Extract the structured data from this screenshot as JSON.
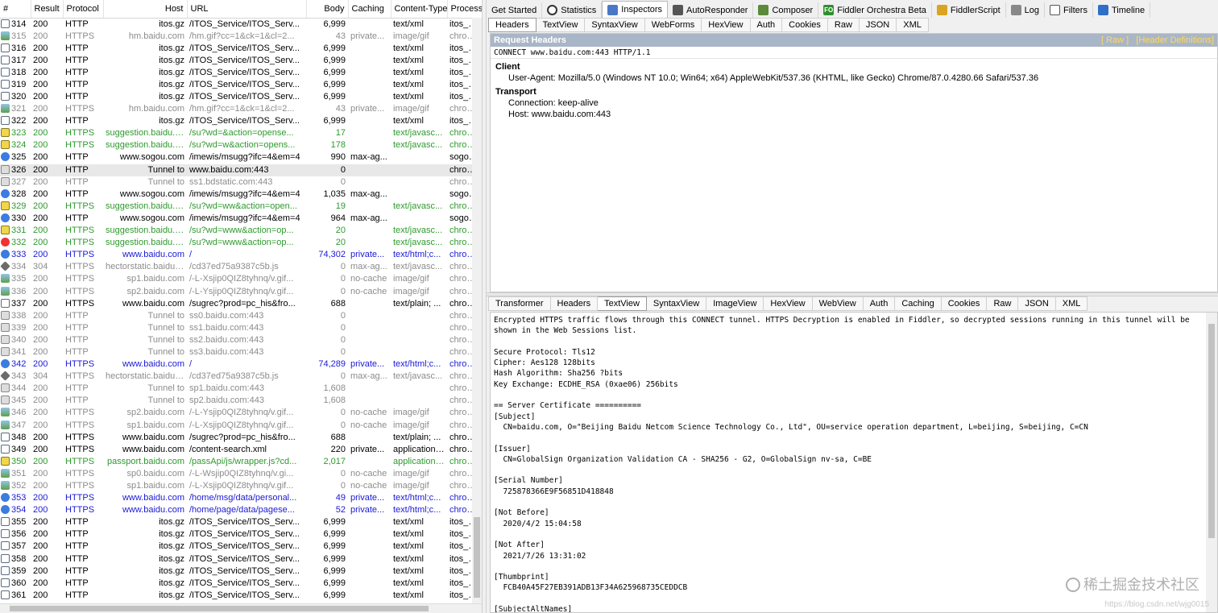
{
  "sessions": {
    "columns": [
      "#",
      "Result",
      "Protocol",
      "Host",
      "URL",
      "Body",
      "Caching",
      "Content-Type",
      "Process"
    ],
    "rows": [
      {
        "id": "314",
        "result": "200",
        "protocol": "HTTP",
        "host": "itos.gz",
        "url": "/ITOS_Service/ITOS_Serv...",
        "body": "6,999",
        "caching": "",
        "ctype": "text/xml",
        "process": "itos_se...",
        "color": "#000000",
        "icon": "doc-icon"
      },
      {
        "id": "315",
        "result": "200",
        "protocol": "HTTPS",
        "host": "hm.baidu.com",
        "url": "/hm.gif?cc=1&ck=1&cl=2...",
        "body": "43",
        "caching": "private...",
        "ctype": "image/gif",
        "process": "chrome...",
        "color": "#8c8c8c",
        "icon": "image-icon"
      },
      {
        "id": "316",
        "result": "200",
        "protocol": "HTTP",
        "host": "itos.gz",
        "url": "/ITOS_Service/ITOS_Serv...",
        "body": "6,999",
        "caching": "",
        "ctype": "text/xml",
        "process": "itos_se...",
        "color": "#000000",
        "icon": "doc-icon"
      },
      {
        "id": "317",
        "result": "200",
        "protocol": "HTTP",
        "host": "itos.gz",
        "url": "/ITOS_Service/ITOS_Serv...",
        "body": "6,999",
        "caching": "",
        "ctype": "text/xml",
        "process": "itos_se...",
        "color": "#000000",
        "icon": "doc-icon"
      },
      {
        "id": "318",
        "result": "200",
        "protocol": "HTTP",
        "host": "itos.gz",
        "url": "/ITOS_Service/ITOS_Serv...",
        "body": "6,999",
        "caching": "",
        "ctype": "text/xml",
        "process": "itos_se...",
        "color": "#000000",
        "icon": "doc-icon"
      },
      {
        "id": "319",
        "result": "200",
        "protocol": "HTTP",
        "host": "itos.gz",
        "url": "/ITOS_Service/ITOS_Serv...",
        "body": "6,999",
        "caching": "",
        "ctype": "text/xml",
        "process": "itos_se...",
        "color": "#000000",
        "icon": "doc-icon"
      },
      {
        "id": "320",
        "result": "200",
        "protocol": "HTTP",
        "host": "itos.gz",
        "url": "/ITOS_Service/ITOS_Serv...",
        "body": "6,999",
        "caching": "",
        "ctype": "text/xml",
        "process": "itos_se...",
        "color": "#000000",
        "icon": "doc-icon"
      },
      {
        "id": "321",
        "result": "200",
        "protocol": "HTTPS",
        "host": "hm.baidu.com",
        "url": "/hm.gif?cc=1&ck=1&cl=2...",
        "body": "43",
        "caching": "private...",
        "ctype": "image/gif",
        "process": "chrome...",
        "color": "#8c8c8c",
        "icon": "image-icon"
      },
      {
        "id": "322",
        "result": "200",
        "protocol": "HTTP",
        "host": "itos.gz",
        "url": "/ITOS_Service/ITOS_Serv...",
        "body": "6,999",
        "caching": "",
        "ctype": "text/xml",
        "process": "itos_se...",
        "color": "#000000",
        "icon": "doc-icon"
      },
      {
        "id": "323",
        "result": "200",
        "protocol": "HTTPS",
        "host": "suggestion.baidu.com",
        "url": "/su?wd=&action=opense...",
        "body": "17",
        "caching": "",
        "ctype": "text/javasc...",
        "process": "chrome...",
        "color": "#2e9a2e",
        "icon": "js-icon"
      },
      {
        "id": "324",
        "result": "200",
        "protocol": "HTTPS",
        "host": "suggestion.baidu.com",
        "url": "/su?wd=w&action=opens...",
        "body": "178",
        "caching": "",
        "ctype": "text/javasc...",
        "process": "chrome...",
        "color": "#2e9a2e",
        "icon": "js-icon"
      },
      {
        "id": "325",
        "result": "200",
        "protocol": "HTTP",
        "host": "www.sogou.com",
        "url": "/imewis/msugg?ifc=4&em=4",
        "body": "990",
        "caching": "max-ag...",
        "ctype": "",
        "process": "sogoucl...",
        "color": "#000000",
        "icon": "arrow-icon"
      },
      {
        "id": "326",
        "result": "200",
        "protocol": "HTTP",
        "host": "Tunnel to",
        "url": "www.baidu.com:443",
        "body": "0",
        "caching": "",
        "ctype": "",
        "process": "chrome...",
        "color": "#000000",
        "icon": "lock-icon"
      },
      {
        "id": "327",
        "result": "200",
        "protocol": "HTTP",
        "host": "Tunnel to",
        "url": "ss1.bdstatic.com:443",
        "body": "0",
        "caching": "",
        "ctype": "",
        "process": "chrome...",
        "color": "#8c8c8c",
        "icon": "lock-icon"
      },
      {
        "id": "328",
        "result": "200",
        "protocol": "HTTP",
        "host": "www.sogou.com",
        "url": "/imewis/msugg?ifc=4&em=4",
        "body": "1,035",
        "caching": "max-ag...",
        "ctype": "",
        "process": "sogoucl...",
        "color": "#000000",
        "icon": "arrow-icon"
      },
      {
        "id": "329",
        "result": "200",
        "protocol": "HTTPS",
        "host": "suggestion.baidu.com",
        "url": "/su?wd=ww&action=open...",
        "body": "19",
        "caching": "",
        "ctype": "text/javasc...",
        "process": "chrome...",
        "color": "#2e9a2e",
        "icon": "js-icon"
      },
      {
        "id": "330",
        "result": "200",
        "protocol": "HTTP",
        "host": "www.sogou.com",
        "url": "/imewis/msugg?ifc=4&em=4",
        "body": "964",
        "caching": "max-ag...",
        "ctype": "",
        "process": "sogoucl...",
        "color": "#000000",
        "icon": "arrow-icon"
      },
      {
        "id": "331",
        "result": "200",
        "protocol": "HTTPS",
        "host": "suggestion.baidu.com",
        "url": "/su?wd=www&action=op...",
        "body": "20",
        "caching": "",
        "ctype": "text/javasc...",
        "process": "chrome...",
        "color": "#2e9a2e",
        "icon": "js-icon"
      },
      {
        "id": "332",
        "result": "200",
        "protocol": "HTTPS",
        "host": "suggestion.baidu.com",
        "url": "/su?wd=www&action=op...",
        "body": "20",
        "caching": "",
        "ctype": "text/javasc...",
        "process": "chrome...",
        "color": "#2e9a2e",
        "icon": "stop-icon"
      },
      {
        "id": "333",
        "result": "200",
        "protocol": "HTTPS",
        "host": "www.baidu.com",
        "url": "/",
        "body": "74,302",
        "caching": "private...",
        "ctype": "text/html;c...",
        "process": "chrome...",
        "color": "#1a1ad6",
        "icon": "arrow-icon"
      },
      {
        "id": "334",
        "result": "304",
        "protocol": "HTTPS",
        "host": "hectorstatic.baidu.c...",
        "url": "/cd37ed75a9387c5b.js",
        "body": "0",
        "caching": "max-ag...",
        "ctype": "text/javasc...",
        "process": "chrome...",
        "color": "#8c8c8c",
        "icon": "css-icon"
      },
      {
        "id": "335",
        "result": "200",
        "protocol": "HTTPS",
        "host": "sp1.baidu.com",
        "url": "/-L-Xsjip0QIZ8tyhnq/v.gif...",
        "body": "0",
        "caching": "no-cache",
        "ctype": "image/gif",
        "process": "chrome...",
        "color": "#8c8c8c",
        "icon": "image-icon"
      },
      {
        "id": "336",
        "result": "200",
        "protocol": "HTTPS",
        "host": "sp2.baidu.com",
        "url": "/-L-Ysjip0QIZ8tyhnq/v.gif...",
        "body": "0",
        "caching": "no-cache",
        "ctype": "image/gif",
        "process": "chrome...",
        "color": "#8c8c8c",
        "icon": "image-icon"
      },
      {
        "id": "337",
        "result": "200",
        "protocol": "HTTPS",
        "host": "www.baidu.com",
        "url": "/sugrec?prod=pc_his&fro...",
        "body": "688",
        "caching": "",
        "ctype": "text/plain; ...",
        "process": "chrome...",
        "color": "#000000",
        "icon": "doc-icon"
      },
      {
        "id": "338",
        "result": "200",
        "protocol": "HTTP",
        "host": "Tunnel to",
        "url": "ss0.baidu.com:443",
        "body": "0",
        "caching": "",
        "ctype": "",
        "process": "chrome...",
        "color": "#8c8c8c",
        "icon": "lock-icon"
      },
      {
        "id": "339",
        "result": "200",
        "protocol": "HTTP",
        "host": "Tunnel to",
        "url": "ss1.baidu.com:443",
        "body": "0",
        "caching": "",
        "ctype": "",
        "process": "chrome...",
        "color": "#8c8c8c",
        "icon": "lock-icon"
      },
      {
        "id": "340",
        "result": "200",
        "protocol": "HTTP",
        "host": "Tunnel to",
        "url": "ss2.baidu.com:443",
        "body": "0",
        "caching": "",
        "ctype": "",
        "process": "chrome...",
        "color": "#8c8c8c",
        "icon": "lock-icon"
      },
      {
        "id": "341",
        "result": "200",
        "protocol": "HTTP",
        "host": "Tunnel to",
        "url": "ss3.baidu.com:443",
        "body": "0",
        "caching": "",
        "ctype": "",
        "process": "chrome...",
        "color": "#8c8c8c",
        "icon": "lock-icon"
      },
      {
        "id": "342",
        "result": "200",
        "protocol": "HTTPS",
        "host": "www.baidu.com",
        "url": "/",
        "body": "74,289",
        "caching": "private...",
        "ctype": "text/html;c...",
        "process": "chrome...",
        "color": "#1a1ad6",
        "icon": "arrow-icon"
      },
      {
        "id": "343",
        "result": "304",
        "protocol": "HTTPS",
        "host": "hectorstatic.baidu.c...",
        "url": "/cd37ed75a9387c5b.js",
        "body": "0",
        "caching": "max-ag...",
        "ctype": "text/javasc...",
        "process": "chrome...",
        "color": "#8c8c8c",
        "icon": "css-icon"
      },
      {
        "id": "344",
        "result": "200",
        "protocol": "HTTP",
        "host": "Tunnel to",
        "url": "sp1.baidu.com:443",
        "body": "1,608",
        "caching": "",
        "ctype": "",
        "process": "chrome...",
        "color": "#8c8c8c",
        "icon": "lock-icon"
      },
      {
        "id": "345",
        "result": "200",
        "protocol": "HTTP",
        "host": "Tunnel to",
        "url": "sp2.baidu.com:443",
        "body": "1,608",
        "caching": "",
        "ctype": "",
        "process": "chrome...",
        "color": "#8c8c8c",
        "icon": "lock-icon"
      },
      {
        "id": "346",
        "result": "200",
        "protocol": "HTTPS",
        "host": "sp2.baidu.com",
        "url": "/-L-Ysjip0QIZ8tyhnq/v.gif...",
        "body": "0",
        "caching": "no-cache",
        "ctype": "image/gif",
        "process": "chrome...",
        "color": "#8c8c8c",
        "icon": "image-icon"
      },
      {
        "id": "347",
        "result": "200",
        "protocol": "HTTPS",
        "host": "sp1.baidu.com",
        "url": "/-L-Xsjip0QIZ8tyhnq/v.gif...",
        "body": "0",
        "caching": "no-cache",
        "ctype": "image/gif",
        "process": "chrome...",
        "color": "#8c8c8c",
        "icon": "image-icon"
      },
      {
        "id": "348",
        "result": "200",
        "protocol": "HTTPS",
        "host": "www.baidu.com",
        "url": "/sugrec?prod=pc_his&fro...",
        "body": "688",
        "caching": "",
        "ctype": "text/plain; ...",
        "process": "chrome...",
        "color": "#000000",
        "icon": "doc-icon"
      },
      {
        "id": "349",
        "result": "200",
        "protocol": "HTTPS",
        "host": "www.baidu.com",
        "url": "/content-search.xml",
        "body": "220",
        "caching": "private...",
        "ctype": "application/...",
        "process": "chrome...",
        "color": "#000000",
        "icon": "doc-icon"
      },
      {
        "id": "350",
        "result": "200",
        "protocol": "HTTPS",
        "host": "passport.baidu.com",
        "url": "/passApi/js/wrapper.js?cd...",
        "body": "2,017",
        "caching": "",
        "ctype": "application/...",
        "process": "chrome...",
        "color": "#2e9a2e",
        "icon": "js-icon"
      },
      {
        "id": "351",
        "result": "200",
        "protocol": "HTTPS",
        "host": "sp0.baidu.com",
        "url": "/-L-Wsjip0QIZ8tyhnq/v.gi...",
        "body": "0",
        "caching": "no-cache",
        "ctype": "image/gif",
        "process": "chrome...",
        "color": "#8c8c8c",
        "icon": "image-icon"
      },
      {
        "id": "352",
        "result": "200",
        "protocol": "HTTPS",
        "host": "sp1.baidu.com",
        "url": "/-L-Xsjip0QIZ8tyhnq/v.gif...",
        "body": "0",
        "caching": "no-cache",
        "ctype": "image/gif",
        "process": "chrome...",
        "color": "#8c8c8c",
        "icon": "image-icon"
      },
      {
        "id": "353",
        "result": "200",
        "protocol": "HTTPS",
        "host": "www.baidu.com",
        "url": "/home/msg/data/personal...",
        "body": "49",
        "caching": "private...",
        "ctype": "text/html;c...",
        "process": "chrome...",
        "color": "#1a1ad6",
        "icon": "arrow-icon"
      },
      {
        "id": "354",
        "result": "200",
        "protocol": "HTTPS",
        "host": "www.baidu.com",
        "url": "/home/page/data/pagese...",
        "body": "52",
        "caching": "private...",
        "ctype": "text/html;c...",
        "process": "chrome...",
        "color": "#1a1ad6",
        "icon": "arrow-icon"
      },
      {
        "id": "355",
        "result": "200",
        "protocol": "HTTP",
        "host": "itos.gz",
        "url": "/ITOS_Service/ITOS_Serv...",
        "body": "6,999",
        "caching": "",
        "ctype": "text/xml",
        "process": "itos_se...",
        "color": "#000000",
        "icon": "doc-icon"
      },
      {
        "id": "356",
        "result": "200",
        "protocol": "HTTP",
        "host": "itos.gz",
        "url": "/ITOS_Service/ITOS_Serv...",
        "body": "6,999",
        "caching": "",
        "ctype": "text/xml",
        "process": "itos_se...",
        "color": "#000000",
        "icon": "doc-icon"
      },
      {
        "id": "357",
        "result": "200",
        "protocol": "HTTP",
        "host": "itos.gz",
        "url": "/ITOS_Service/ITOS_Serv...",
        "body": "6,999",
        "caching": "",
        "ctype": "text/xml",
        "process": "itos_se...",
        "color": "#000000",
        "icon": "doc-icon"
      },
      {
        "id": "358",
        "result": "200",
        "protocol": "HTTP",
        "host": "itos.gz",
        "url": "/ITOS_Service/ITOS_Serv...",
        "body": "6,999",
        "caching": "",
        "ctype": "text/xml",
        "process": "itos_se...",
        "color": "#000000",
        "icon": "doc-icon"
      },
      {
        "id": "359",
        "result": "200",
        "protocol": "HTTP",
        "host": "itos.gz",
        "url": "/ITOS_Service/ITOS_Serv...",
        "body": "6,999",
        "caching": "",
        "ctype": "text/xml",
        "process": "itos_se...",
        "color": "#000000",
        "icon": "doc-icon"
      },
      {
        "id": "360",
        "result": "200",
        "protocol": "HTTP",
        "host": "itos.gz",
        "url": "/ITOS_Service/ITOS_Serv...",
        "body": "6,999",
        "caching": "",
        "ctype": "text/xml",
        "process": "itos_se...",
        "color": "#000000",
        "icon": "doc-icon"
      },
      {
        "id": "361",
        "result": "200",
        "protocol": "HTTP",
        "host": "itos.gz",
        "url": "/ITOS_Service/ITOS_Serv...",
        "body": "6,999",
        "caching": "",
        "ctype": "text/xml",
        "process": "itos_se...",
        "color": "#000000",
        "icon": "doc-icon"
      }
    ]
  },
  "main_tabs": [
    {
      "label": "Get Started",
      "icon": "",
      "selected": false
    },
    {
      "label": "Statistics",
      "icon": "clock-icon",
      "selected": false
    },
    {
      "label": "Inspectors",
      "icon": "magnifier-icon",
      "selected": true
    },
    {
      "label": "AutoResponder",
      "icon": "lightning-icon",
      "selected": false
    },
    {
      "label": "Composer",
      "icon": "pencil-icon",
      "selected": false
    },
    {
      "label": "Fiddler Orchestra Beta",
      "icon": "fo-icon",
      "selected": false
    },
    {
      "label": "FiddlerScript",
      "icon": "script-icon",
      "selected": false
    },
    {
      "label": "Log",
      "icon": "log-icon",
      "selected": false
    },
    {
      "label": "Filters",
      "icon": "checkbox-icon",
      "selected": false
    },
    {
      "label": "Timeline",
      "icon": "timeline-icon",
      "selected": false
    }
  ],
  "fo_icon_text": "FO",
  "request_tabs": [
    "Headers",
    "TextView",
    "SyntaxView",
    "WebForms",
    "HexView",
    "Auth",
    "Cookies",
    "Raw",
    "JSON",
    "XML"
  ],
  "request_selected": "Headers",
  "request": {
    "title": "Request Headers",
    "raw_link": "[ Raw ]",
    "defs_link": "[Header Definitions]",
    "line": "CONNECT www.baidu.com:443 HTTP/1.1",
    "groups": [
      {
        "name": "Client",
        "items": [
          "User-Agent: Mozilla/5.0 (Windows NT 10.0; Win64; x64) AppleWebKit/537.36 (KHTML, like Gecko) Chrome/87.0.4280.66 Safari/537.36"
        ]
      },
      {
        "name": "Transport",
        "items": [
          "Connection: keep-alive",
          "Host: www.baidu.com:443"
        ]
      }
    ]
  },
  "response_tabs": [
    "Transformer",
    "Headers",
    "TextView",
    "SyntaxView",
    "ImageView",
    "HexView",
    "WebView",
    "Auth",
    "Caching",
    "Cookies",
    "Raw",
    "JSON",
    "XML"
  ],
  "response_selected": "TextView",
  "response_text": "Encrypted HTTPS traffic flows through this CONNECT tunnel. HTTPS Decryption is enabled in Fiddler, so decrypted sessions running in this tunnel will be shown in the Web Sessions list.\n\nSecure Protocol: Tls12\nCipher: Aes128 128bits\nHash Algorithm: Sha256 ?bits\nKey Exchange: ECDHE_RSA (0xae06) 256bits\n\n== Server Certificate ==========\n[Subject]\n  CN=baidu.com, O=\"Beijing Baidu Netcom Science Technology Co., Ltd\", OU=service operation department, L=beijing, S=beijing, C=CN\n\n[Issuer]\n  CN=GlobalSign Organization Validation CA - SHA256 - G2, O=GlobalSign nv-sa, C=BE\n\n[Serial Number]\n  725878366E9F56851D418848\n\n[Not Before]\n  2020/4/2 15:04:58\n\n[Not After]\n  2021/7/26 13:31:02\n\n[Thumbprint]\n  FCB40A45F27EB391ADB13F34A625968735CEDDCB\n\n[SubjectAltNames]",
  "watermark": "稀土掘金技术社区",
  "watermark_url": "https://blog.csdn.net/wjg0015"
}
